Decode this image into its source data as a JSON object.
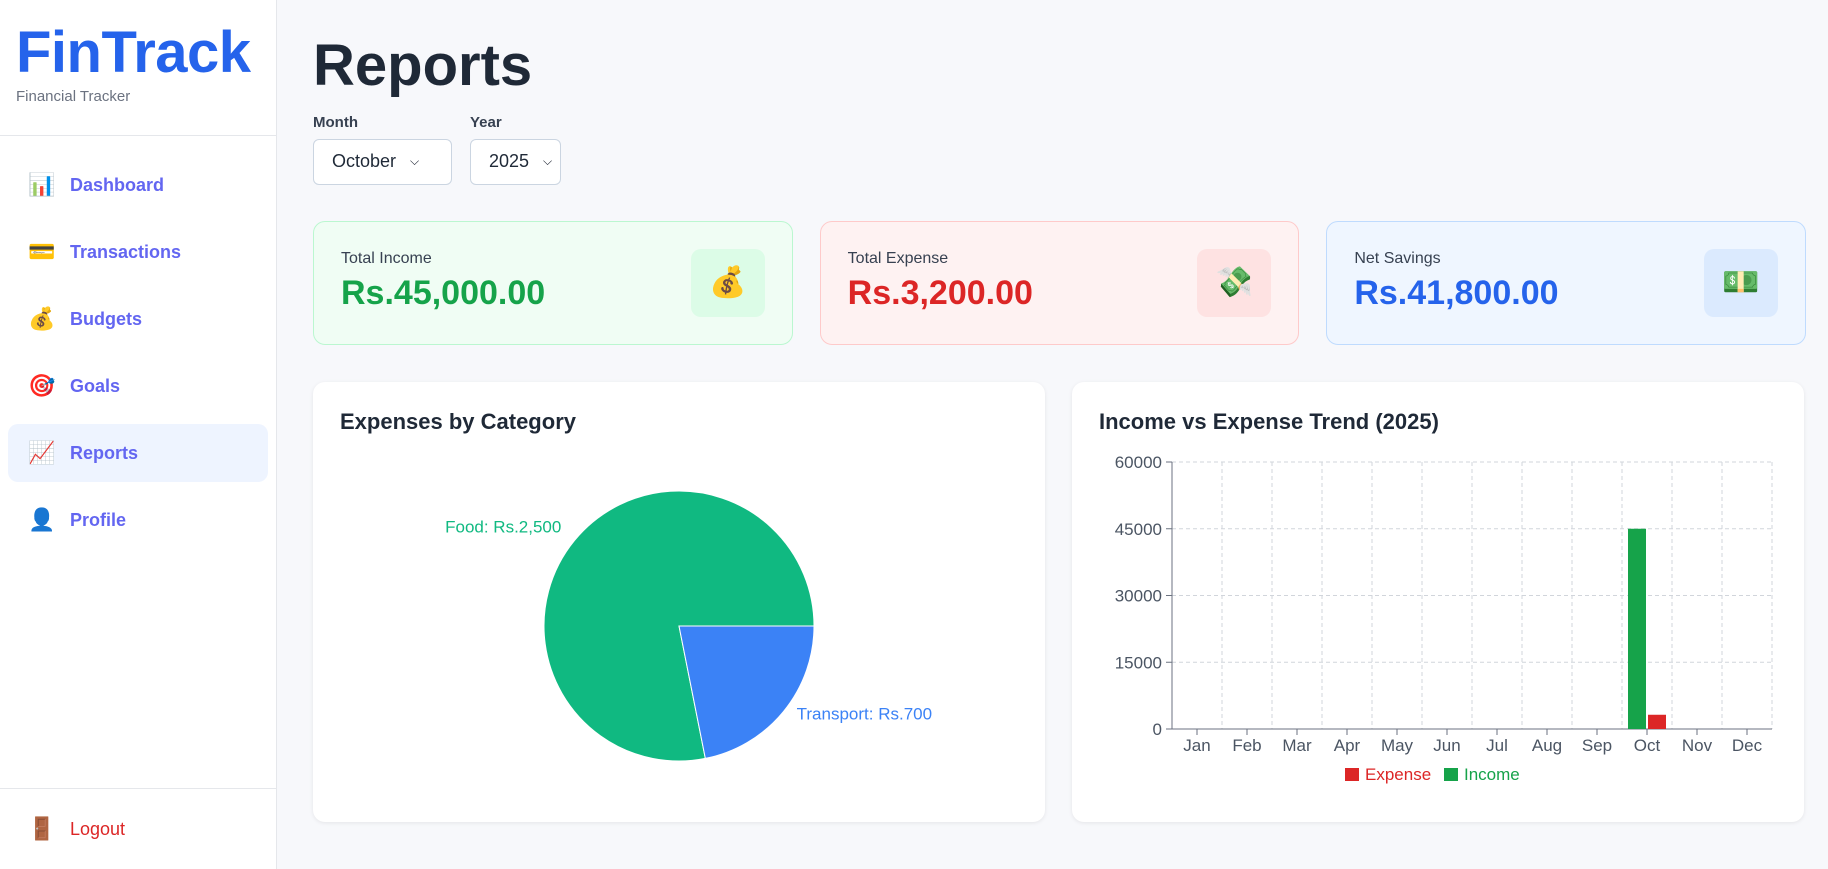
{
  "app": {
    "name": "FinTrack",
    "tagline": "Financial Tracker"
  },
  "sidebar": {
    "items": [
      {
        "label": "Dashboard",
        "icon": "bar-chart-icon",
        "glyph": "📊",
        "active": false
      },
      {
        "label": "Transactions",
        "icon": "credit-card-icon",
        "glyph": "💳",
        "active": false
      },
      {
        "label": "Budgets",
        "icon": "money-bag-icon",
        "glyph": "💰",
        "active": false
      },
      {
        "label": "Goals",
        "icon": "target-icon",
        "glyph": "🎯",
        "active": false
      },
      {
        "label": "Reports",
        "icon": "trend-chart-icon",
        "glyph": "📈",
        "active": true
      },
      {
        "label": "Profile",
        "icon": "user-icon",
        "glyph": "👤",
        "active": false
      }
    ],
    "logout": {
      "label": "Logout",
      "icon": "door-icon",
      "glyph": "🚪"
    }
  },
  "page": {
    "title": "Reports"
  },
  "filters": {
    "month": {
      "label": "Month",
      "value": "October"
    },
    "year": {
      "label": "Year",
      "value": "2025"
    }
  },
  "summary": {
    "income": {
      "label": "Total Income",
      "value": "Rs.45,000.00",
      "icon": "money-bag-icon",
      "glyph": "💰",
      "color": "#16a34a"
    },
    "expense": {
      "label": "Total Expense",
      "value": "Rs.3,200.00",
      "icon": "money-wings-icon",
      "glyph": "💸",
      "color": "#dc2626"
    },
    "savings": {
      "label": "Net Savings",
      "value": "Rs.41,800.00",
      "icon": "dollar-bill-icon",
      "glyph": "💵",
      "color": "#2563eb"
    }
  },
  "panels": {
    "pie_title": "Expenses by Category",
    "trend_title": "Income vs Expense Trend (2025)"
  },
  "chart_data": [
    {
      "type": "pie",
      "title": "Expenses by Category",
      "slices": [
        {
          "name": "Food",
          "label": "Food: Rs.2,500",
          "value": 2500,
          "color": "#10b981"
        },
        {
          "name": "Transport",
          "label": "Transport: Rs.700",
          "value": 700,
          "color": "#3b82f6"
        }
      ]
    },
    {
      "type": "bar",
      "title": "Income vs Expense Trend (2025)",
      "categories": [
        "Jan",
        "Feb",
        "Mar",
        "Apr",
        "May",
        "Jun",
        "Jul",
        "Aug",
        "Sep",
        "Oct",
        "Nov",
        "Dec"
      ],
      "series": [
        {
          "name": "Income",
          "color": "#16a34a",
          "values": [
            0,
            0,
            0,
            0,
            0,
            0,
            0,
            0,
            0,
            45000,
            0,
            0
          ]
        },
        {
          "name": "Expense",
          "color": "#dc2626",
          "values": [
            0,
            0,
            0,
            0,
            0,
            0,
            0,
            0,
            0,
            3200,
            0,
            0
          ]
        }
      ],
      "yticks": [
        0,
        15000,
        30000,
        45000,
        60000
      ],
      "ylim": [
        0,
        60000
      ],
      "grid": true,
      "legend": "bottom",
      "legend_order": [
        "Expense",
        "Income"
      ]
    }
  ]
}
